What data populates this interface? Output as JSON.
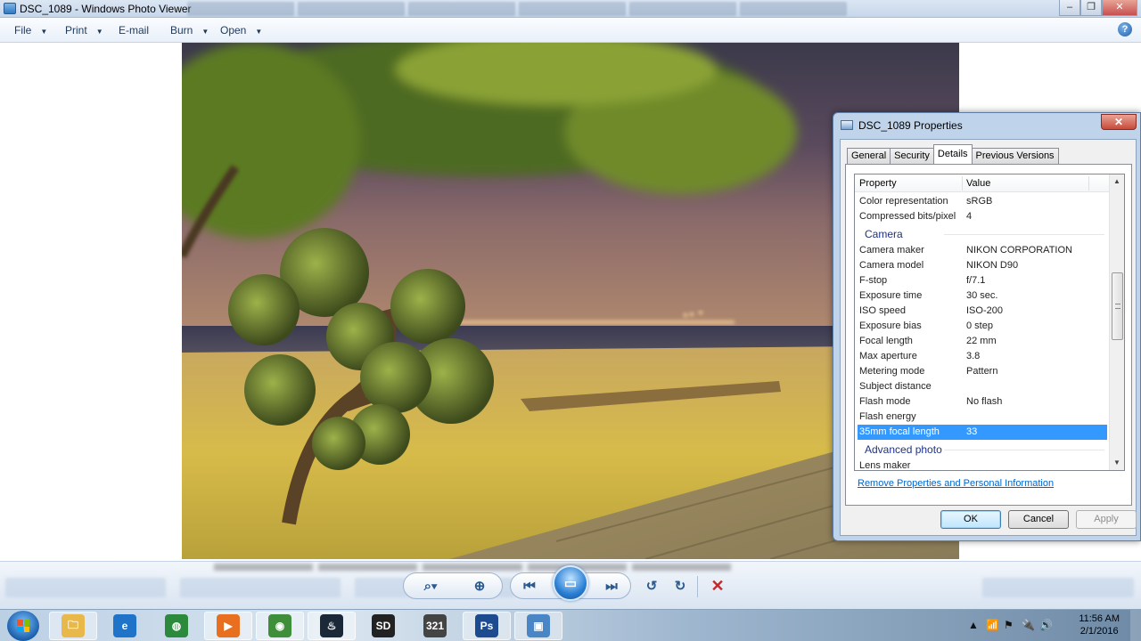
{
  "window": {
    "title": "DSC_1089 - Windows Photo Viewer"
  },
  "menu": {
    "items": [
      {
        "label": "File",
        "has_dropdown": true
      },
      {
        "label": "Print",
        "has_dropdown": true
      },
      {
        "label": "E-mail",
        "has_dropdown": false
      },
      {
        "label": "Burn",
        "has_dropdown": true
      },
      {
        "label": "Open",
        "has_dropdown": true
      }
    ],
    "help_label": "?"
  },
  "photo": {
    "description_icon": "beach-night-photo"
  },
  "controls": {
    "buttons": [
      {
        "name": "zoom-button",
        "icon": "magnifier-icon",
        "glyph": "⌕▾"
      },
      {
        "name": "actual-size-button",
        "icon": "fit-window-icon",
        "glyph": "⊕"
      },
      {
        "name": "previous-button",
        "icon": "previous-icon",
        "glyph": "⏮"
      },
      {
        "name": "slideshow-button",
        "icon": "slideshow-icon",
        "glyph": "▭"
      },
      {
        "name": "next-button",
        "icon": "next-icon",
        "glyph": "⏭"
      },
      {
        "name": "rotate-ccw-button",
        "icon": "rotate-ccw-icon",
        "glyph": "↺"
      },
      {
        "name": "rotate-cw-button",
        "icon": "rotate-cw-icon",
        "glyph": "↻"
      },
      {
        "name": "delete-button",
        "icon": "delete-icon",
        "glyph": "✕"
      }
    ]
  },
  "dialog": {
    "title": "DSC_1089 Properties",
    "close_glyph": "✕",
    "tabs": [
      "General",
      "Security",
      "Details",
      "Previous Versions"
    ],
    "selected_tab": "Details",
    "columns": {
      "property": "Property",
      "value": "Value"
    },
    "rows_top": [
      {
        "k": "Color representation",
        "v": "sRGB"
      },
      {
        "k": "Compressed bits/pixel",
        "v": "4"
      }
    ],
    "group_camera": "Camera",
    "rows_camera": [
      {
        "k": "Camera maker",
        "v": "NIKON CORPORATION"
      },
      {
        "k": "Camera model",
        "v": "NIKON D90"
      },
      {
        "k": "F-stop",
        "v": "f/7.1"
      },
      {
        "k": "Exposure time",
        "v": "30 sec."
      },
      {
        "k": "ISO speed",
        "v": "ISO-200"
      },
      {
        "k": "Exposure bias",
        "v": "0 step"
      },
      {
        "k": "Focal length",
        "v": "22 mm"
      },
      {
        "k": "Max aperture",
        "v": "3.8"
      },
      {
        "k": "Metering mode",
        "v": "Pattern"
      },
      {
        "k": "Subject distance",
        "v": ""
      },
      {
        "k": "Flash mode",
        "v": "No flash"
      },
      {
        "k": "Flash energy",
        "v": ""
      }
    ],
    "selected_row": {
      "k": "35mm focal length",
      "v": "33"
    },
    "group_advanced": "Advanced photo",
    "rows_advanced": [
      {
        "k": "Lens maker",
        "v": ""
      }
    ],
    "remove_link": "Remove Properties and Personal Information",
    "buttons": {
      "ok": "OK",
      "cancel": "Cancel",
      "apply": "Apply"
    },
    "scroll_position": 0.42
  },
  "taskbar": {
    "apps": [
      {
        "name": "explorer-icon",
        "color": "#e8b84a",
        "glyph": "🗀",
        "active": true
      },
      {
        "name": "ie-icon",
        "color": "#1f74c9",
        "glyph": "e",
        "active": false
      },
      {
        "name": "media-app-icon",
        "color": "#2c8a3c",
        "glyph": "◍",
        "active": false
      },
      {
        "name": "media-player-icon",
        "color": "#e76f1f",
        "glyph": "▶",
        "active": true
      },
      {
        "name": "chrome-icon",
        "color": "#3f8f3a",
        "glyph": "◉",
        "active": true
      },
      {
        "name": "steam-icon",
        "color": "#1b2838",
        "glyph": "♨",
        "active": true
      },
      {
        "name": "sleeping-dogs-icon",
        "color": "#222222",
        "glyph": "SD",
        "active": false
      },
      {
        "name": "media-321-icon",
        "color": "#444444",
        "glyph": "321",
        "active": false
      },
      {
        "name": "photoshop-icon",
        "color": "#1d4b8f",
        "glyph": "Ps",
        "active": true
      },
      {
        "name": "photo-viewer-icon",
        "color": "#4a86c6",
        "glyph": "▣",
        "active": true
      }
    ],
    "time": "11:56 AM",
    "date": "2/1/2016",
    "tray_glyphs": [
      "▲",
      "📶",
      "⚑",
      "🔌",
      "🔊"
    ]
  },
  "colors": {
    "accent": "#3399ff",
    "link": "#0066cc",
    "delete": "#c62828"
  }
}
